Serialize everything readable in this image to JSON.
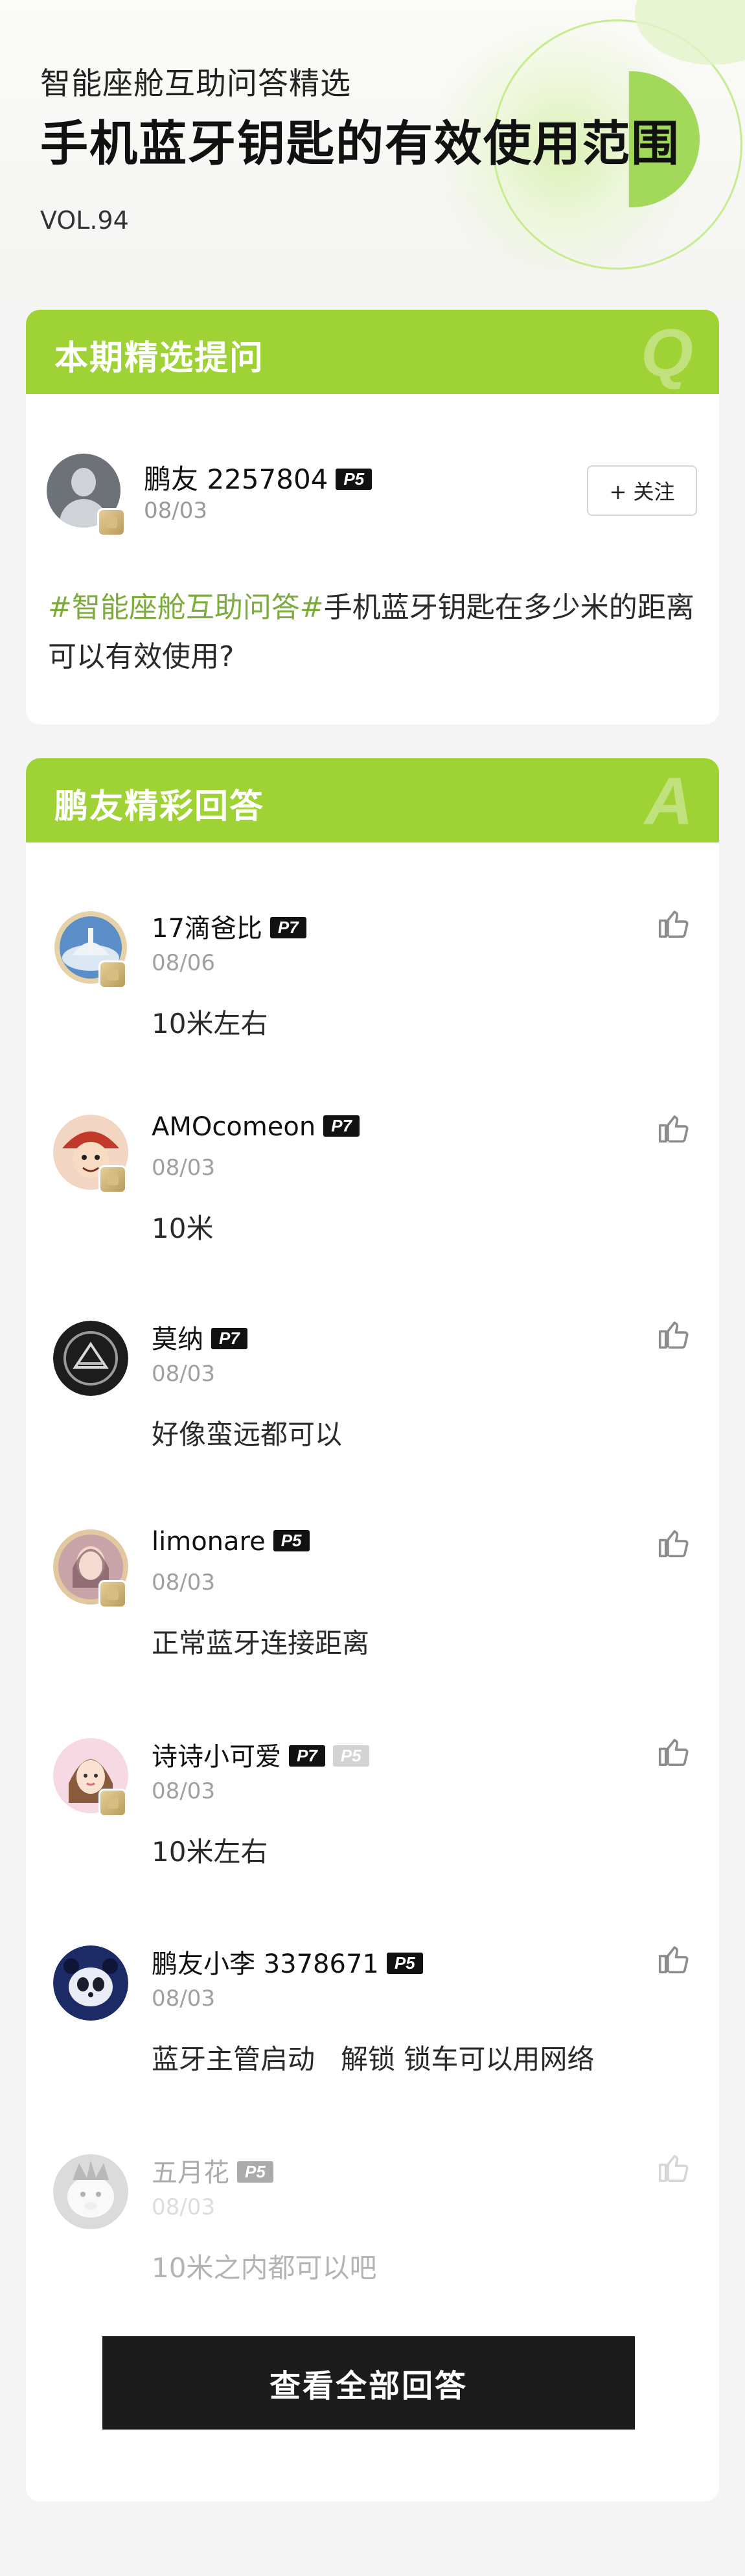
{
  "header": {
    "subtitle": "智能座舱互助问答精选",
    "title": "手机蓝牙钥匙的有效使用范围",
    "volume": "VOL.94"
  },
  "question_section": {
    "heading": "本期精选提问",
    "watermark": "Q",
    "author": {
      "name": "鹏友 2257804",
      "level": "P5",
      "date": "08/03"
    },
    "follow_label": "+ 关注",
    "topic_tag": "#智能座舱互助问答#",
    "question_text": "手机蓝牙钥匙在多少米的距离可以有效使用?"
  },
  "answers_section": {
    "heading": "鹏友精彩回答",
    "watermark": "A",
    "answers": [
      {
        "name": "17滴爸比",
        "level": "P7",
        "date": "08/06",
        "text": "10米左右",
        "avatar": "sky-photo-avatar"
      },
      {
        "name": "AMOcomeon",
        "level": "P7",
        "date": "08/03",
        "text": "10米",
        "avatar": "cartoon-pirate-avatar"
      },
      {
        "name": "莫纳",
        "level": "P7",
        "date": "08/03",
        "text": "好像蛮远都可以",
        "avatar": "car-logo-avatar"
      },
      {
        "name": "limonare",
        "level": "P5",
        "date": "08/03",
        "text": "正常蓝牙连接距离",
        "avatar": "portrait-avatar"
      },
      {
        "name": "诗诗小可爱",
        "level": "P7",
        "level2": "P5",
        "date": "08/03",
        "text": "10米左右",
        "avatar": "cartoon-girl-avatar"
      },
      {
        "name": "鹏友小李 3378671",
        "level": "P5",
        "date": "08/03",
        "text": "蓝牙主管启动   解锁 锁车可以用网络",
        "avatar": "panda-avatar"
      },
      {
        "name": "五月花",
        "level": "P5",
        "date": "08/03",
        "text": "10米之内都可以吧",
        "avatar": "cartoon-mascot-avatar"
      }
    ],
    "view_all_label": "查看全部回答"
  },
  "colors": {
    "accent_green": "#9ed235",
    "tag_green": "#7dab3c",
    "button_dark": "#1b1b1b"
  }
}
